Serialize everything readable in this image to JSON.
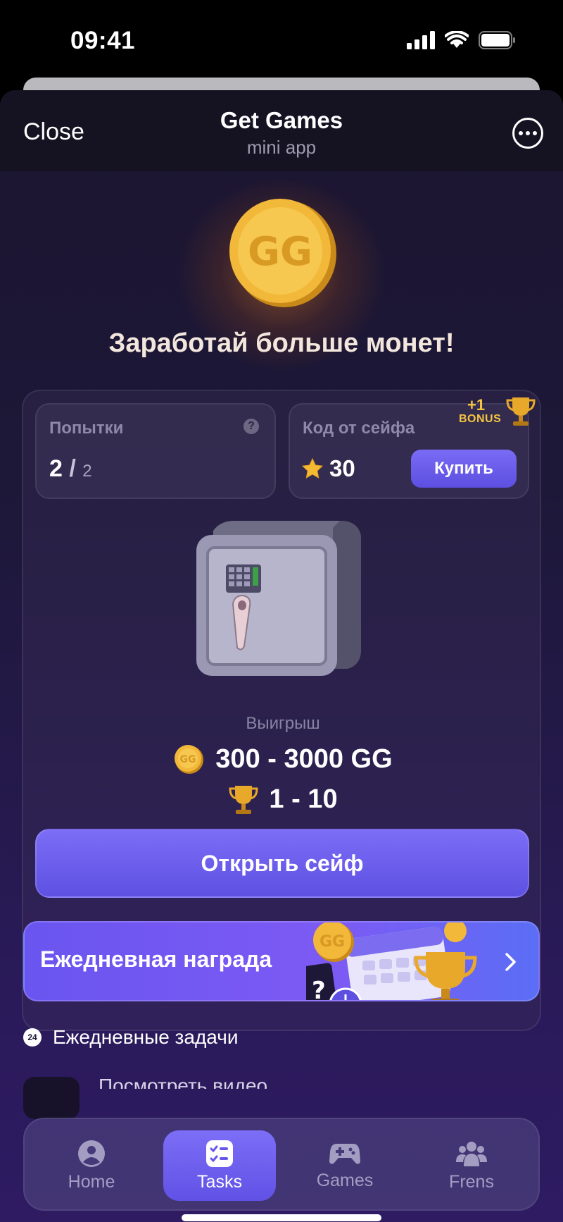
{
  "status_bar": {
    "time": "09:41"
  },
  "header": {
    "close_label": "Close",
    "title": "Get Games",
    "subtitle": "mini app"
  },
  "hero": {
    "title": "Заработай больше монет!"
  },
  "attempts": {
    "label": "Попытки",
    "used": "2",
    "slash": "/",
    "max": "2"
  },
  "safe_code": {
    "label": "Код от сейфа",
    "price": "30",
    "buy_label": "Купить"
  },
  "bonus": {
    "plus": "+1",
    "word": "BONUS"
  },
  "winnings": {
    "label": "Выигрыш",
    "coins_range": "300 - 3000 GG",
    "cups_range": "1 - 10"
  },
  "open_safe_label": "Открыть сейф",
  "daily_reward": {
    "label": "Ежедневная награда"
  },
  "daily_tasks": {
    "badge": "24",
    "label": "Ежедневные задачи",
    "first_task_peek": "Посмотреть видео"
  },
  "nav": {
    "items": [
      {
        "label": "Home",
        "icon": "person-icon"
      },
      {
        "label": "Tasks",
        "icon": "checklist-icon",
        "active": true
      },
      {
        "label": "Games",
        "icon": "gamepad-icon"
      },
      {
        "label": "Frens",
        "icon": "friends-icon"
      }
    ]
  },
  "colors": {
    "accent": "#6a5cf0",
    "gold": "#f5c542",
    "bg_dark": "#1d1838"
  }
}
